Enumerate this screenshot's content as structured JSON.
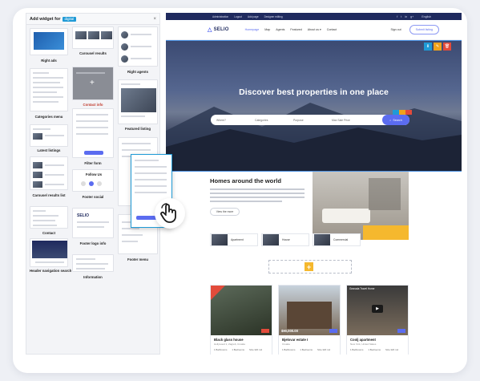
{
  "panel": {
    "title": "Add widget for",
    "badge": "digital",
    "close": "×",
    "widgets": {
      "right_ads": "Right ads",
      "carousel": "Carousel results",
      "right_agents": "Right agents",
      "categories_menu": "Categories menu",
      "contact_info": "Contact info",
      "featured_listing": "Featured listing",
      "latest_listings": "Latest listings",
      "filter_form": "Filter form",
      "carousel_list": "Carousel results list",
      "follow_us": "Follow Us",
      "footer_social": "Footer social",
      "contact": "Contact",
      "footer_logo_info": "Footer logo info",
      "footer_menu": "Footer menu",
      "header_nav": "Header navigation search",
      "information": "Information"
    },
    "logo_text": "SELIO"
  },
  "site": {
    "topbar": [
      "Administration",
      "Logout",
      "Add page",
      "Designer editing"
    ],
    "topbar_icons": [
      "f",
      "t",
      "in",
      "g+",
      "English"
    ],
    "logo": "SELIO",
    "nav": [
      "Homepage",
      "Map",
      "Agents",
      "Featured",
      "About us ▾",
      "Contact"
    ],
    "sign_out": "Sign out",
    "submit": "Submit listing",
    "hero_title": "Discover best properties in one place",
    "search_fields": [
      "Where?",
      "Categories",
      "Purpose",
      "Max Sale Price"
    ],
    "search_button": "Search",
    "homes_title": "Homes around the world",
    "view_button": "View the more",
    "categories": [
      "Apartment",
      "House",
      "Commercial"
    ],
    "add_plus": "+",
    "properties": [
      {
        "name": "Black glass house",
        "addr": "Hollywood 1, Zagreb, Croatia",
        "price": "",
        "meta": [
          "1 Bathrooms",
          "1 Bedrooms",
          "Size 320 m2"
        ]
      },
      {
        "name": "Bjelovar estate I",
        "addr": "Croatia",
        "price": "$90,000.00",
        "meta": [
          "1 Bathrooms",
          "1 Bedrooms",
          "Size 320 m2"
        ]
      },
      {
        "name": "Coolj apartment",
        "addr": "New York, United States",
        "price": "",
        "meta": [
          "1 Bathrooms",
          "1 Bedrooms",
          "Size 320 m2"
        ]
      }
    ],
    "video_title": "Granada Travel Home"
  },
  "colors": {
    "accent": "#5b6cf0",
    "topbar": "#1f2a5e",
    "yellow": "#f5b82e",
    "tool_blue": "#1f9ad6",
    "tool_orange": "#f0a21b",
    "tool_red": "#e24b3b"
  }
}
